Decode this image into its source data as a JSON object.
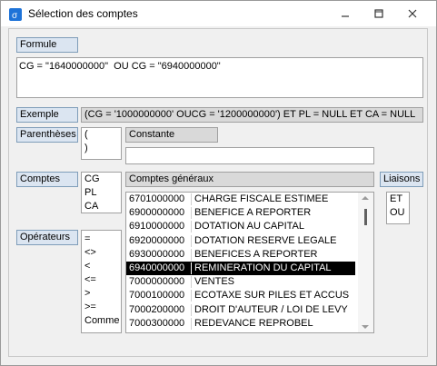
{
  "window": {
    "title": "Sélection des comptes",
    "icon": "app-icon"
  },
  "formule": {
    "label": "Formule",
    "value": "CG = \"1640000000\"  OU CG = \"6940000000\""
  },
  "exemple": {
    "label": "Exemple",
    "value": "(CG = '1000000000' OUCG = '1200000000') ET PL = NULL ET CA = NULL"
  },
  "parentheses": {
    "label": "Parenthèses",
    "items": [
      "(",
      ")"
    ]
  },
  "constante": {
    "label": "Constante",
    "value": ""
  },
  "comptes": {
    "label": "Comptes",
    "items": [
      "CG",
      "PL",
      "CA"
    ]
  },
  "comptes_generaux": {
    "label": "Comptes généraux",
    "rows": [
      {
        "code": "6701000000",
        "name": "CHARGE FISCALE ESTIMEE"
      },
      {
        "code": "6900000000",
        "name": "BENEFICE A REPORTER"
      },
      {
        "code": "6910000000",
        "name": "DOTATION AU CAPITAL"
      },
      {
        "code": "6920000000",
        "name": "DOTATION RESERVE LEGALE"
      },
      {
        "code": "6930000000",
        "name": "BENEFICES A REPORTER"
      },
      {
        "code": "6940000000",
        "name": "REMINERATION DU CAPITAL"
      },
      {
        "code": "7000000000",
        "name": "VENTES"
      },
      {
        "code": "7000100000",
        "name": "ECOTAXE SUR PILES ET ACCUS"
      },
      {
        "code": "7000200000",
        "name": "DROIT D'AUTEUR / LOI DE LEVY"
      },
      {
        "code": "7000300000",
        "name": "REDEVANCE REPROBEL"
      }
    ],
    "selected_code": "6940000000"
  },
  "liaisons": {
    "label": "Liaisons",
    "items": [
      "ET",
      "OU"
    ]
  },
  "operateurs": {
    "label": "Opérateurs",
    "items": [
      "=",
      "<>",
      "<",
      "<=",
      ">",
      ">=",
      "Comme"
    ]
  },
  "colors": {
    "label_bg": "#dbe5f1",
    "label_border": "#7f9db9",
    "selection_bg": "#000000",
    "icon_blue": "#1e73d8"
  }
}
